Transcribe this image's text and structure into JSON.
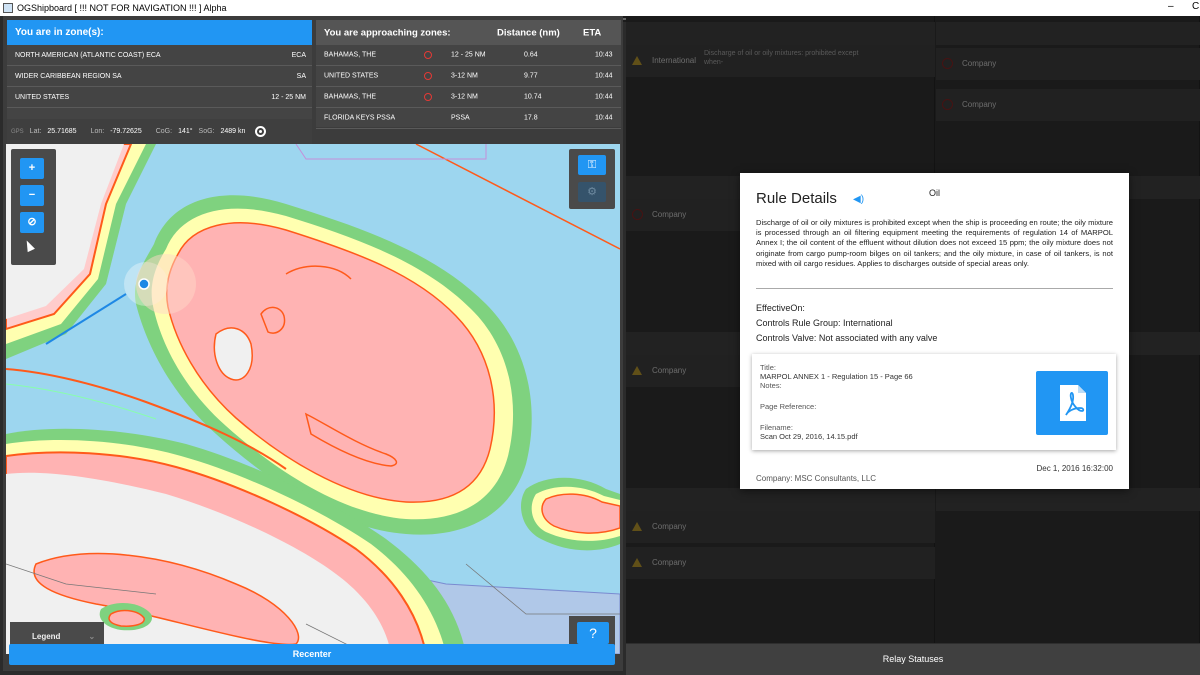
{
  "window": {
    "title": "OGShipboard [ !!! NOT FOR NAVIGATION !!! ] Alpha",
    "minimize": "–",
    "close": "C"
  },
  "zones": {
    "heading": "You are in zone(s):",
    "rows": [
      {
        "name": "NORTH AMERICAN (ATLANTIC COAST) ECA",
        "value": "ECA"
      },
      {
        "name": "WIDER CARIBBEAN REGION SA",
        "value": "SA"
      },
      {
        "name": "UNITED STATES",
        "value": "12 - 25 NM"
      }
    ]
  },
  "approaching": {
    "heading": "You are approaching zones:",
    "distance_header": "Distance (nm)",
    "eta_header": "ETA",
    "rows": [
      {
        "name": "BAHAMAS, THE",
        "range": "12 - 25 NM",
        "distance": "0.64",
        "eta": "10:43",
        "warning": true
      },
      {
        "name": "UNITED STATES",
        "range": "3-12 NM",
        "distance": "9.77",
        "eta": "10:44",
        "warning": true
      },
      {
        "name": "BAHAMAS, THE",
        "range": "3-12 NM",
        "distance": "10.74",
        "eta": "10:44",
        "warning": true
      },
      {
        "name": "FLORIDA KEYS PSSA",
        "range": "PSSA",
        "distance": "17.8",
        "eta": "10:44",
        "warning": false
      }
    ]
  },
  "gps": {
    "icon_label": "GPS",
    "lat_label": "Lat:",
    "lat": "25.71685",
    "lon_label": "Lon:",
    "lon": "-79.72625",
    "cog_label": "CoG:",
    "cog": "141°",
    "sog_label": "SoG:",
    "sog": "2489 kn"
  },
  "map": {
    "legend_label": "Legend",
    "help_label": "?",
    "recenter_label": "Recenter",
    "icons": [
      "zoom-in-icon",
      "zoom-out-icon",
      "compass-icon",
      "pointer-icon",
      "key-icon",
      "gear-icon"
    ]
  },
  "rules_panel": {
    "cards": [
      {
        "label": "International",
        "text": "Discharge of oil or oily mixtures: prohibited except when-"
      },
      {
        "label": "Company"
      },
      {
        "label": "Company"
      },
      {
        "label": "Company"
      },
      {
        "label": "Company"
      },
      {
        "label": "Company"
      },
      {
        "label": "Company"
      }
    ],
    "relay_label": "Relay Statuses"
  },
  "modal": {
    "title": "Rule Details",
    "tag": "Oil",
    "description": "Discharge of oil or oily mixtures is prohibited except when the ship is proceeding en route; the oily mixture is processed through an oil filtering equipment meeting the requirements of regulation 14 of MARPOL Annex I; the oil content of the effluent without dilution does not exceed 15 ppm; the oily mixture does not originate from cargo pump-room bilges on oil tankers; and the oily mixture, in case of oil tankers, is not mixed with oil cargo residues. Applies to discharges outside of special areas only.",
    "effective_on": "EffectiveOn:",
    "controls_rule_group": "Controls Rule Group: International",
    "controls_valve": "Controls Valve: Not associated with any valve",
    "document": {
      "title_label": "Title:",
      "title": "MARPOL ANNEX 1 - Regulation 15 - Page 66",
      "notes_label": "Notes:",
      "page_ref_label": "Page Reference:",
      "filename_label": "Filename:",
      "filename": "Scan Oct 29, 2016, 14.15.pdf"
    },
    "date": "Dec 1, 2016 16:32:00",
    "company": "Company: MSC Consultants, LLC"
  },
  "colors": {
    "accent": "#2196f3",
    "land": "#ffb3b3",
    "coast": "#ff5a1a",
    "water": "#9dd6ef",
    "warning": "#e53935"
  }
}
